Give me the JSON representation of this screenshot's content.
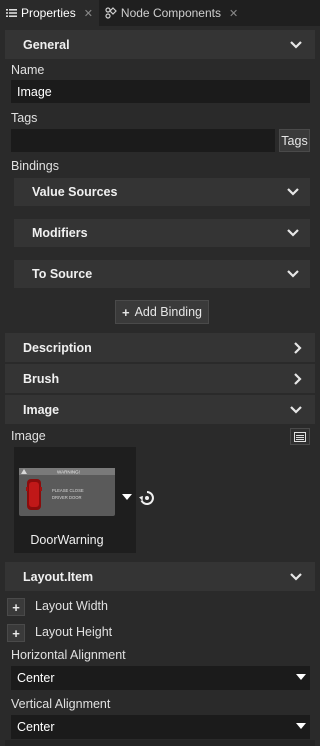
{
  "tabs": [
    {
      "label": "Properties",
      "icon": "list-icon",
      "active": true
    },
    {
      "label": "Node Components",
      "icon": "node-components-icon",
      "active": false
    }
  ],
  "general": {
    "header": "General",
    "name_label": "Name",
    "name_value": "Image",
    "tags_label": "Tags",
    "tags_value": "",
    "tags_button": "Tags",
    "bindings_label": "Bindings",
    "value_sources": "Value Sources",
    "modifiers": "Modifiers",
    "to_source": "To Source",
    "add_binding": "Add Binding"
  },
  "sections": {
    "description": "Description",
    "brush": "Brush",
    "image": "Image",
    "layout_item": "Layout.Item"
  },
  "image_section": {
    "label": "Image",
    "asset_name": "DoorWarning",
    "thumbnail": {
      "warning_title": "WARNING!",
      "line1": "PLEASE CLOSE",
      "line2": "DRIVER DOOR"
    }
  },
  "layout": {
    "layout_width": "Layout Width",
    "layout_height": "Layout Height",
    "horizontal_alignment_label": "Horizontal Alignment",
    "horizontal_alignment_value": "Center",
    "vertical_alignment_label": "Vertical Alignment",
    "vertical_alignment_value": "Center"
  },
  "colors": {
    "background": "#2a2a2a",
    "header": "#343434",
    "field": "#1b1b1b",
    "warning_red": "#c01818"
  }
}
